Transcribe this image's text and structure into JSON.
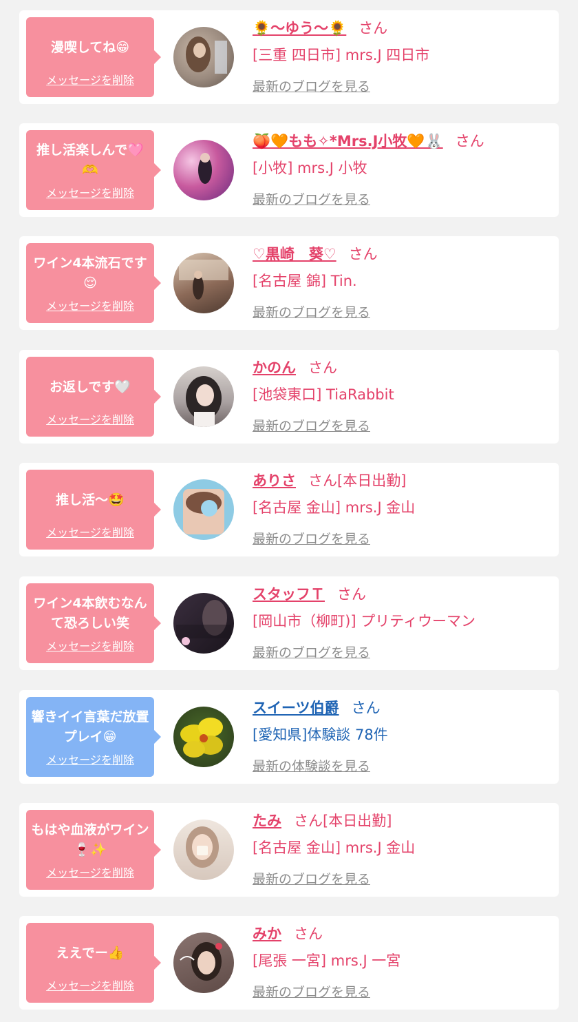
{
  "cards": [
    {
      "message": "漫喫してね😁",
      "delete_label": "メッセージを削除",
      "name": "🌻〜ゆう〜🌻",
      "suffix": "さん",
      "sub": "[三重 四日市] mrs.J 四日市",
      "link": "最新のブログを見る",
      "theme": "pink",
      "avatar_color": "#9a8a7e"
    },
    {
      "message": "推し活楽しんで🩷🫶",
      "delete_label": "メッセージを削除",
      "name": "🍑🧡もも✧*Mrs.J小牧🧡🐰",
      "suffix": "さん",
      "sub": "[小牧] mrs.J 小牧",
      "link": "最新のブログを見る",
      "theme": "pink",
      "avatar_color": "#c85a9e"
    },
    {
      "message": "ワイン4本流石です😌",
      "delete_label": "メッセージを削除",
      "name": "♡黒崎　葵♡",
      "suffix": "さん",
      "sub": "[名古屋 錦] Tin.",
      "link": "最新のブログを見る",
      "theme": "pink",
      "avatar_color": "#8c6a58"
    },
    {
      "message": "お返しです🤍",
      "delete_label": "メッセージを削除",
      "name": "かのん",
      "suffix": "さん",
      "sub": "[池袋東口] TiaRabbit",
      "link": "最新のブログを見る",
      "theme": "pink",
      "avatar_color": "#6e6464"
    },
    {
      "message": "推し活〜🤩",
      "delete_label": "メッセージを削除",
      "name": "ありさ",
      "suffix": "さん[本日出勤]",
      "sub": "[名古屋 金山] mrs.J 金山",
      "link": "最新のブログを見る",
      "theme": "pink",
      "avatar_color": "#8ecbe4"
    },
    {
      "message": "ワイン4本飲むなんて恐ろしい笑",
      "delete_label": "メッセージを削除",
      "name": "スタッフＴ",
      "suffix": "さん",
      "sub": "[岡山市（柳町)] プリティウーマン",
      "link": "最新のブログを見る",
      "theme": "pink",
      "avatar_color": "#2a2230"
    },
    {
      "message": "響きイイ言葉だ放置プレイ😁",
      "delete_label": "メッセージを削除",
      "name": "スイーツ伯爵",
      "suffix": "さん",
      "sub": "[愛知県]体験談 78件",
      "link": "最新の体験談を見る",
      "theme": "blue",
      "avatar_color": "#d8c21a"
    },
    {
      "message": "もはや血液がワイン🍷✨",
      "delete_label": "メッセージを削除",
      "name": "たみ",
      "suffix": "さん[本日出勤]",
      "sub": "[名古屋 金山] mrs.J 金山",
      "link": "最新のブログを見る",
      "theme": "pink",
      "avatar_color": "#d7c8bd"
    },
    {
      "message": "ええでー👍",
      "delete_label": "メッセージを削除",
      "name": "みか",
      "suffix": "さん",
      "sub": "[尾張 一宮] mrs.J 一宮",
      "link": "最新のブログを見る",
      "theme": "pink",
      "avatar_color": "#5e4a46"
    }
  ],
  "colors": {
    "pink": "#f7909e",
    "blue": "#84b4f5",
    "pink_text": "#e4426a",
    "blue_text": "#1f64b4",
    "link_gray": "#8c8c8c"
  }
}
